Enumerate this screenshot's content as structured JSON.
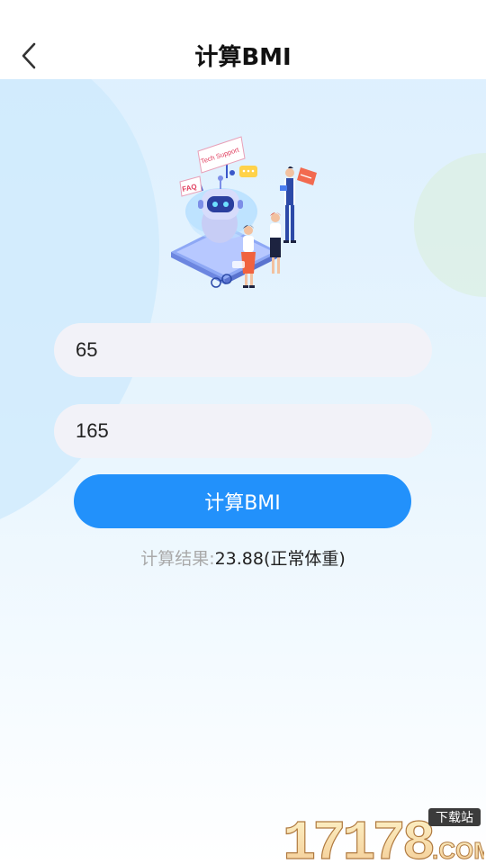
{
  "header": {
    "title": "计算BMI",
    "back_icon": "chevron-left-icon"
  },
  "illustration": {
    "labels": {
      "faq": "FAQ",
      "tech_support": "Tech Support"
    }
  },
  "form": {
    "weight_value": "65",
    "height_value": "165",
    "calculate_label": "计算BMI"
  },
  "result": {
    "label": "计算结果:",
    "value": "23.88(正常体重)"
  },
  "watermark": {
    "number": "17178",
    "tag": "下载站",
    "suffix": ".COM"
  },
  "colors": {
    "accent": "#2291fb",
    "input_bg": "#f2f2f8",
    "result_label": "#a9a9a9"
  }
}
